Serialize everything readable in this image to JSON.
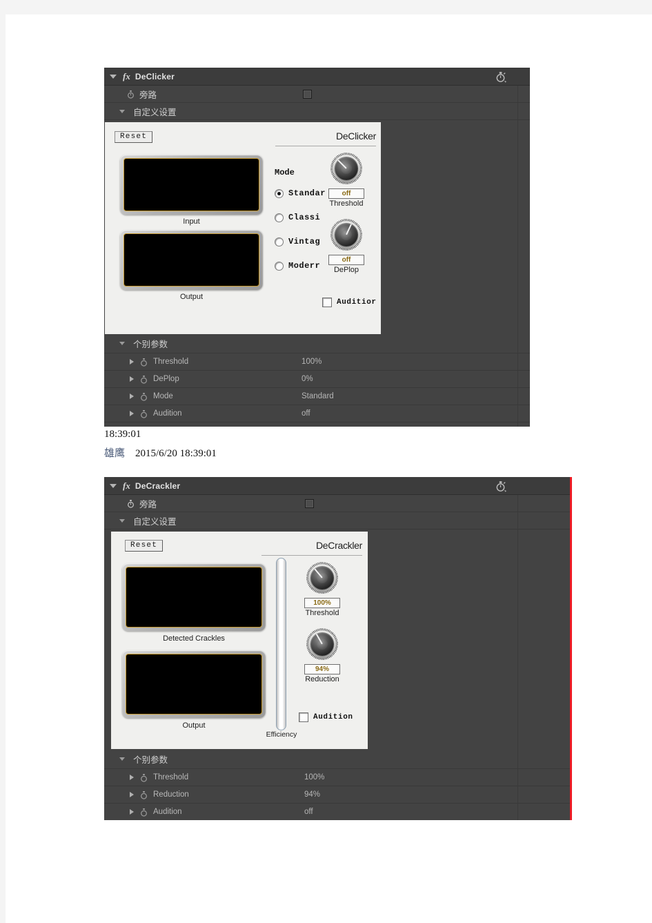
{
  "effects": [
    {
      "id": "declicker",
      "title": "DeClicker",
      "fx_icon": "fx-icon",
      "animation_icon": "stopwatch-icon",
      "bypass_label": "旁路",
      "custom_setup_label": "自定义设置",
      "individual_params_label": "个别参数",
      "plugin": {
        "reset_label": "Reset",
        "brand": "DeClicker",
        "scopes": [
          {
            "label": "Input"
          },
          {
            "label": "Output"
          }
        ],
        "mode_title": "Mode",
        "modes": [
          {
            "label": "Standar",
            "selected": true
          },
          {
            "label": "Classi",
            "selected": false
          },
          {
            "label": "Vintag",
            "selected": false
          },
          {
            "label": "Moderr",
            "selected": false
          }
        ],
        "knobs": [
          {
            "readout": "off",
            "caption": "Threshold",
            "angle": 135
          },
          {
            "readout": "off",
            "caption": "DePlop",
            "angle": 205
          }
        ],
        "audition": {
          "label": "Auditior",
          "checked": false
        }
      },
      "params": [
        {
          "name": "Threshold",
          "value": "100%"
        },
        {
          "name": "DePlop",
          "value": "0%"
        },
        {
          "name": "Mode",
          "value": "Standard"
        },
        {
          "name": "Audition",
          "value": "off"
        }
      ]
    },
    {
      "id": "decrackler",
      "title": "DeCrackler",
      "fx_icon": "fx-icon",
      "animation_icon": "stopwatch-icon",
      "bypass_label": "旁路",
      "custom_setup_label": "自定义设置",
      "individual_params_label": "个别参数",
      "plugin": {
        "reset_label": "Reset",
        "brand": "DeCrackler",
        "scopes": [
          {
            "label": "Detected Crackles"
          },
          {
            "label": "Output"
          }
        ],
        "slider": {
          "caption": "Efficiency",
          "value": 0
        },
        "knobs": [
          {
            "readout": "100%",
            "caption": "Threshold",
            "angle": 140
          },
          {
            "readout": "94%",
            "caption": "Reduction",
            "angle": 150
          }
        ],
        "audition": {
          "label": "Audition",
          "checked": false
        }
      },
      "params": [
        {
          "name": "Threshold",
          "value": "100%"
        },
        {
          "name": "Reduction",
          "value": "94%"
        },
        {
          "name": "Audition",
          "value": "off"
        }
      ]
    }
  ],
  "chat": {
    "time_line": "18:39:01",
    "nickname": "雄鹰",
    "message_meta": "2015/6/20  18:39:01"
  },
  "colors": {
    "panel_bg": "#434343",
    "panel_title_bg": "#3c3c3c",
    "value_amber": "#b9a98c",
    "selection_red": "#ee1c25",
    "scope_border": "#c79a2e",
    "readout_text": "#8a6a14"
  }
}
